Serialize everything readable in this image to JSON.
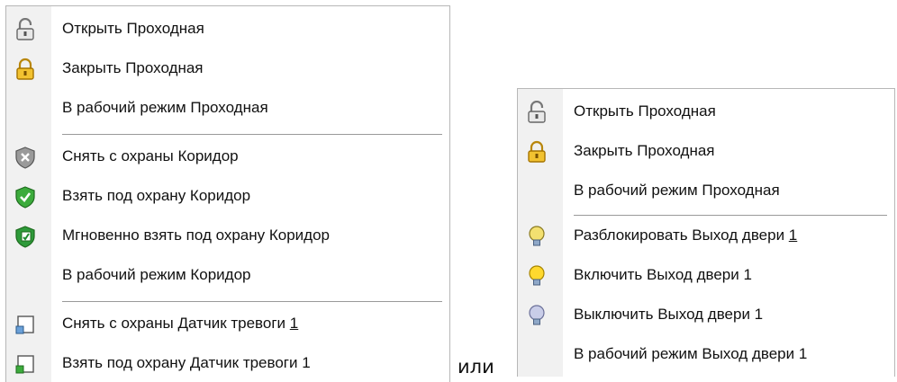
{
  "menu1": {
    "items": [
      {
        "label": "Открыть Проходная",
        "icon": "unlocked-padlock-icon"
      },
      {
        "label": "Закрыть Проходная",
        "icon": "locked-padlock-icon"
      },
      {
        "label": "В рабочий режим Проходная",
        "icon": ""
      },
      {
        "label": "Снять с охраны Коридор",
        "icon": "shield-disarm-icon"
      },
      {
        "label": "Взять под охрану Коридор",
        "icon": "shield-arm-icon"
      },
      {
        "label": "Мгновенно взять под охрану Коридор",
        "icon": "shield-instant-arm-icon"
      },
      {
        "label": "В рабочий режим Коридор",
        "icon": ""
      },
      {
        "label": "Снять с охраны Датчик тревоги ",
        "accel": "1",
        "icon": "sensor-disarm-icon"
      },
      {
        "label": "Взять под охрану Датчик тревоги 1",
        "icon": "sensor-arm-icon"
      }
    ]
  },
  "connector": "или",
  "menu2": {
    "items": [
      {
        "label": "Открыть Проходная",
        "icon": "unlocked-padlock-icon"
      },
      {
        "label": "Закрыть Проходная",
        "icon": "locked-padlock-icon"
      },
      {
        "label": "В рабочий режим Проходная",
        "icon": ""
      },
      {
        "label": "Разблокировать Выход двери ",
        "accel": "1",
        "icon": "lightbulb-unlock-icon"
      },
      {
        "label": "Включить Выход двери 1",
        "icon": "lightbulb-on-icon"
      },
      {
        "label": "Выключить Выход двери 1",
        "icon": "lightbulb-off-icon"
      },
      {
        "label": "В рабочий режим Выход двери 1",
        "icon": ""
      }
    ]
  },
  "colors": {
    "menu_border": "#b7b7b7",
    "icon_margin": "#f1f1f1",
    "separator": "#9a9a9a"
  }
}
